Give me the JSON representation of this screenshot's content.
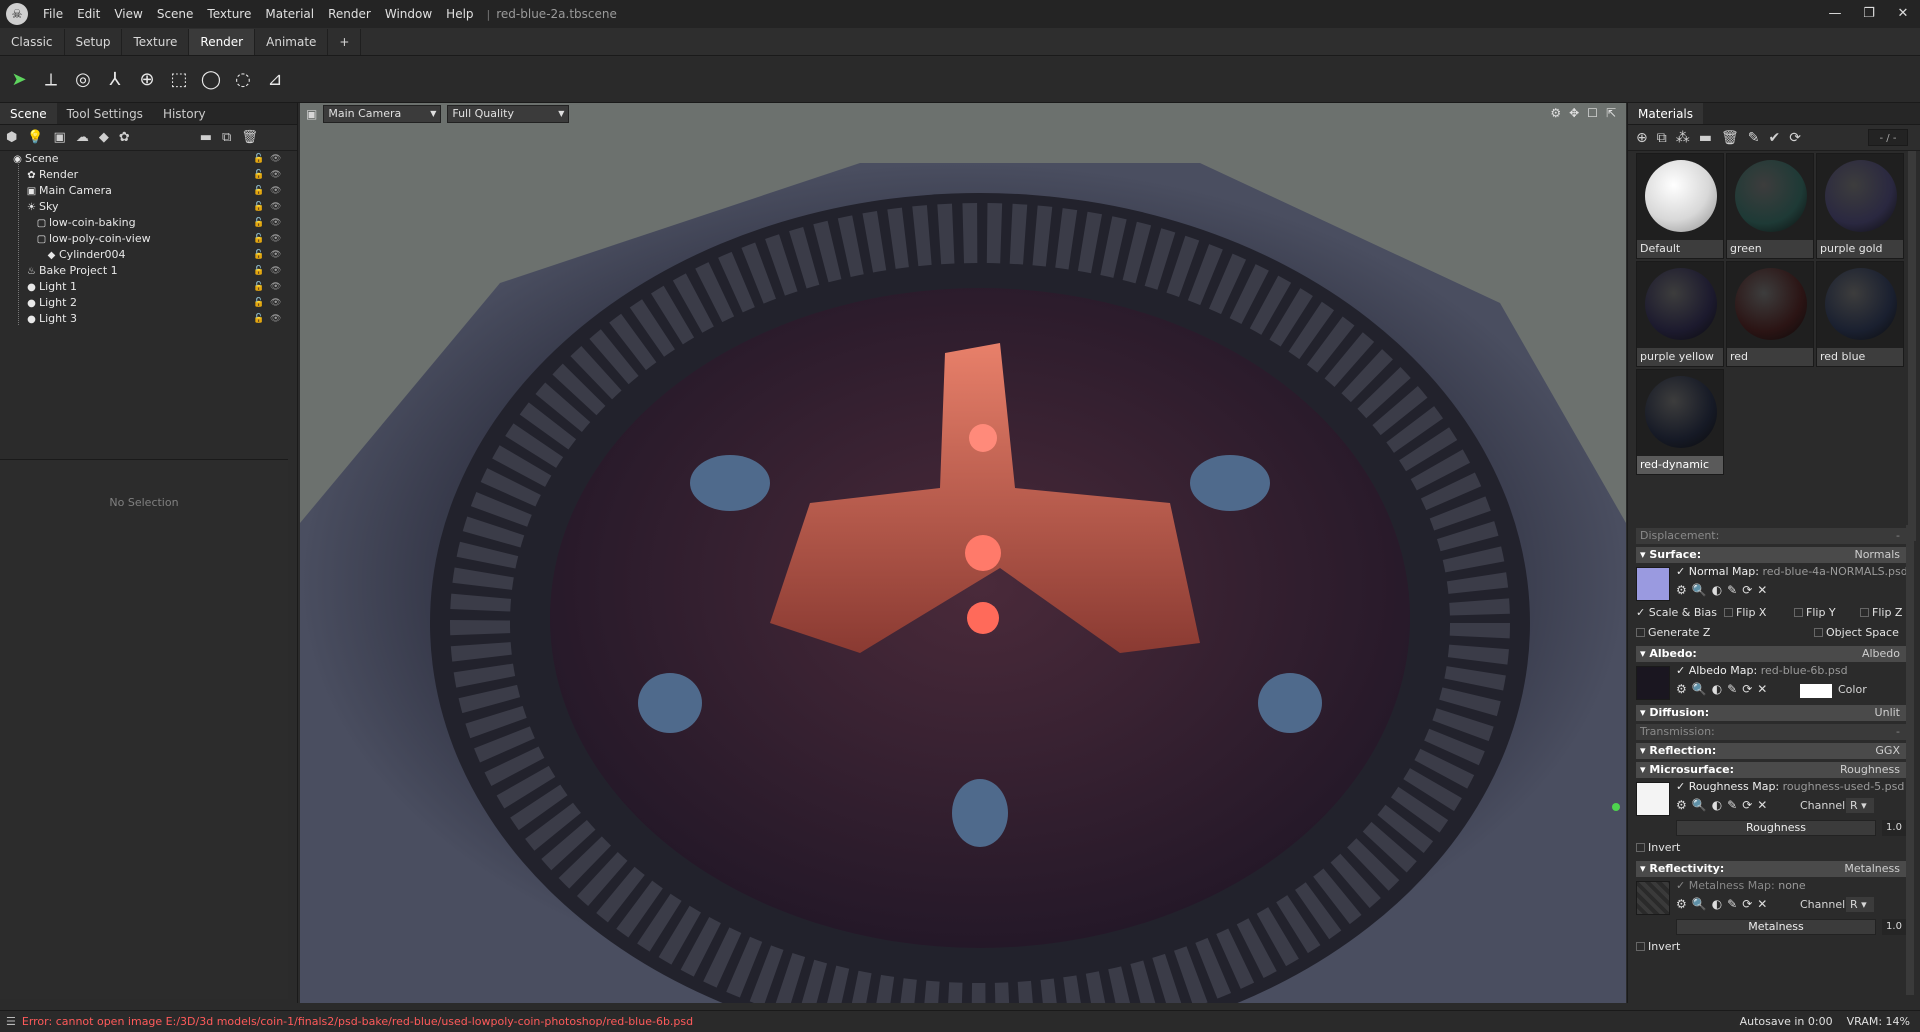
{
  "app": {
    "logo_icon": "skull-logo-icon",
    "document": "red-blue-2a.tbscene"
  },
  "menu": [
    "File",
    "Edit",
    "View",
    "Scene",
    "Texture",
    "Material",
    "Render",
    "Window",
    "Help"
  ],
  "workspace_tabs": [
    "Classic",
    "Setup",
    "Texture",
    "Render",
    "Animate",
    "+"
  ],
  "active_workspace": "Render",
  "scene_panel": {
    "tabs": [
      "Scene",
      "Tool Settings",
      "History"
    ],
    "tree": [
      {
        "label": "Scene",
        "icon": "scene-icon",
        "depth": 0
      },
      {
        "label": "Render",
        "icon": "render-icon",
        "depth": 1
      },
      {
        "label": "Main Camera",
        "icon": "camera-icon",
        "depth": 1
      },
      {
        "label": "Sky",
        "icon": "sky-icon",
        "depth": 1
      },
      {
        "label": "low-coin-baking",
        "icon": "mesh-icon",
        "depth": 2
      },
      {
        "label": "low-poly-coin-view",
        "icon": "mesh-icon",
        "depth": 2
      },
      {
        "label": "Cylinder004",
        "icon": "object-icon",
        "depth": 3
      },
      {
        "label": "Bake Project 1",
        "icon": "bake-icon",
        "depth": 1
      },
      {
        "label": "Light 1",
        "icon": "light-icon",
        "depth": 1
      },
      {
        "label": "Light 2",
        "icon": "light-icon",
        "depth": 1
      },
      {
        "label": "Light 3",
        "icon": "light-icon",
        "depth": 1
      }
    ],
    "no_selection": "No Selection"
  },
  "viewport": {
    "camera": "Main Camera",
    "quality": "Full Quality"
  },
  "materials_panel": {
    "title": "Materials",
    "count_label": "- / -",
    "materials": [
      {
        "name": "Default",
        "color": "#f2f2f2"
      },
      {
        "name": "green",
        "color": "#1e3a36"
      },
      {
        "name": "purple gold",
        "color": "#2a2840"
      },
      {
        "name": "purple yellow",
        "color": "#1c1a2e"
      },
      {
        "name": "red",
        "color": "#2b1414"
      },
      {
        "name": "red blue",
        "color": "#1a2030"
      },
      {
        "name": "red-dynamic",
        "color": "#161a26"
      }
    ],
    "selected": "red-dynamic"
  },
  "properties": {
    "displacement": {
      "label": "Displacement:",
      "value": "-"
    },
    "surface": {
      "label": "Surface:",
      "value": "Normals",
      "map_label": "Normal Map:",
      "map_file": "red-blue-4a-NORMALS.psd",
      "scale_bias": "Scale & Bias",
      "flip_x": "Flip X",
      "flip_y": "Flip Y",
      "flip_z": "Flip Z",
      "generate_z": "Generate Z",
      "object_space": "Object Space"
    },
    "albedo": {
      "label": "Albedo:",
      "value": "Albedo",
      "map_label": "Albedo Map:",
      "map_file": "red-blue-6b.psd",
      "color_label": "Color"
    },
    "diffusion": {
      "label": "Diffusion:",
      "value": "Unlit"
    },
    "transmission": {
      "label": "Transmission:",
      "value": "-"
    },
    "reflection": {
      "label": "Reflection:",
      "value": "GGX"
    },
    "microsurface": {
      "label": "Microsurface:",
      "value": "Roughness",
      "map_label": "Roughness Map:",
      "map_file": "roughness-used-5.psd",
      "channel_label": "Channel",
      "channel": "R",
      "slider_label": "Roughness",
      "slider_value": "1.0",
      "invert": "Invert"
    },
    "reflectivity": {
      "label": "Reflectivity:",
      "value": "Metalness",
      "map_label": "Metalness Map:",
      "map_file": "none",
      "channel_label": "Channel",
      "channel": "R",
      "slider_label": "Metalness",
      "slider_value": "1.0",
      "invert": "Invert"
    }
  },
  "status": {
    "error": "Error: cannot open image E:/3D/3d models/coin-1/finals2/psd-bake/red-blue/used-lowpoly-coin-photoshop/red-blue-6b.psd",
    "autosave": "Autosave in 0:00",
    "vram": "VRAM: 14%"
  }
}
